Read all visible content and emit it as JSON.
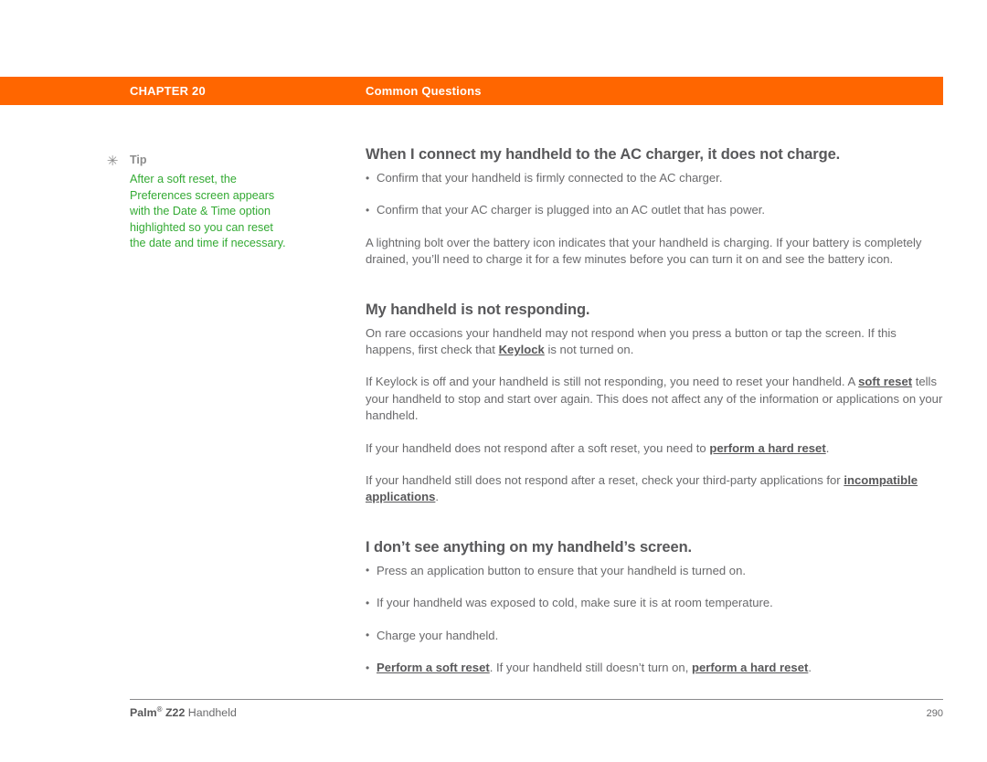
{
  "header": {
    "chapter_label": "CHAPTER 20",
    "section_label": "Common Questions",
    "bar_color": "#ff6600",
    "text_color": "#ffffff"
  },
  "tip": {
    "icon": "asterisk-icon",
    "icon_glyph": "✳",
    "label": "Tip",
    "label_color": "#8c8c8c",
    "text": "After a soft reset, the Preferences screen appears with the Date & Time option highlighted so you can reset the date and time if necessary.",
    "text_color": "#33aa33"
  },
  "sections": [
    {
      "title": "When I connect my handheld to the AC charger, it does not charge.",
      "bullets": [
        "Confirm that your handheld is firmly connected to the AC charger.",
        "Confirm that your AC charger is plugged into an AC outlet that has power."
      ],
      "paragraph": "A lightning bolt over the battery icon indicates that your handheld is charging. If your battery is completely drained, you’ll need to charge it for a few minutes before you can turn it on and see the battery icon."
    },
    {
      "title": "My handheld is not responding.",
      "p1_a": "On rare occasions your handheld may not respond when you press a button or tap the screen. If this happens, first check that ",
      "p1_link": "Keylock",
      "p1_b": " is not turned on.",
      "p2_a": "If Keylock is off and your handheld is still not responding, you need to reset your handheld. A ",
      "p2_link": "soft reset",
      "p2_b": " tells your handheld to stop and start over again. This does not affect any of the information or applications on your handheld.",
      "p3_a": "If your handheld does not respond after a soft reset, you need to ",
      "p3_link": "perform a hard reset",
      "p3_b": ".",
      "p4_a": "If your handheld still does not respond after a reset, check your third-party applications for ",
      "p4_link": "incompatible applications",
      "p4_b": "."
    },
    {
      "title": "I don’t see anything on my handheld’s screen.",
      "bullets": [
        "Press an application button to ensure that your handheld is turned on.",
        "If your handheld was exposed to cold, make sure it is at room temperature.",
        "Charge your handheld."
      ],
      "last_bullet_link1": "Perform a soft reset",
      "last_bullet_mid": ". If your handheld still doesn’t turn on, ",
      "last_bullet_link2": "perform a hard reset",
      "last_bullet_end": "."
    }
  ],
  "footer": {
    "brand": "Palm",
    "registered_mark": "®",
    "model": "Z22",
    "product": "Handheld",
    "page_number": "290"
  }
}
